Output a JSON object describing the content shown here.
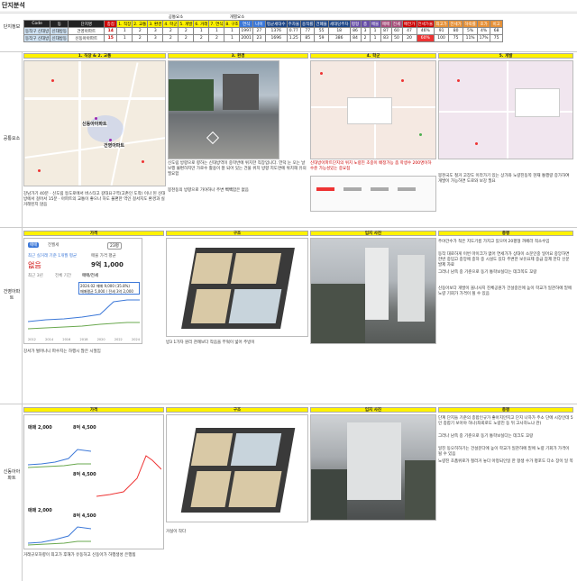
{
  "title": "단지분석",
  "summary": {
    "side_label": "단지정보",
    "group_common": "공통요소",
    "group_indiv": "개별요소",
    "headers": [
      "Code",
      "동",
      "단지명",
      "종점",
      "1. 직장",
      "2. 교통",
      "3. 환경",
      "4. 학군",
      "5. 개발",
      "6. 거래",
      "7. 연식",
      "8. 구조",
      "연식",
      "나이",
      "평균세대수",
      "주차율",
      "용적률",
      "건폐율",
      "세대당주차",
      "평형",
      "층",
      "매물",
      "매매",
      "전세",
      "매전가",
      "전세가율",
      "최고가",
      "전세가",
      "하락률",
      "호가",
      "비고"
    ],
    "rows": [
      [
        "동작구 신대방",
        "신대방동",
        "건영아파트",
        "14",
        "1",
        "2",
        "3",
        "2",
        "2",
        "1",
        "1",
        "1",
        "1997",
        "27",
        "1376",
        "0.77",
        "77",
        "55",
        "18",
        "86",
        "3",
        "1",
        "87",
        "60",
        "47",
        "46%",
        "91",
        "80",
        "5%",
        "4%",
        "68",
        "N"
      ],
      [
        "동작구 신대방",
        "신대방동",
        "신동아아파트",
        "15",
        "1",
        "2",
        "3",
        "2",
        "2",
        "2",
        "2",
        "1",
        "2001",
        "23",
        "1696",
        "1.25",
        "85",
        "59",
        "386",
        "84",
        "2",
        "1",
        "83",
        "50",
        "20",
        "60%",
        "100",
        "75",
        "11%",
        "17%",
        "75",
        "N"
      ]
    ]
  },
  "common": {
    "label": "공통요소",
    "tabs": [
      "1. 직장 & 2. 교통",
      "3. 환경",
      "4. 학군",
      "5. 개발"
    ],
    "map_labels": [
      "신동아아파트",
      "건영아파트"
    ],
    "notes": {
      "transport": "강남가기 40분 · 신도림 등도로에서 버스타고 갈대요구역(고촌인 도착) 이나 된 신대방에서 걸어서 15분 · 아파트의 교통이 좋으나 하도 불편한 역인 걸서지도 환경과 실거래된지 않음",
      "environment": "신도림 방향으로 향하는 신대방역이 중학반에 위치한 직장입니다. 언덕 눈 오는 날 보행 불편하지만 가로수 활용이 잘 되어 있는 건물 위치 방향 지도면에 위치해 유의 필요함",
      "environment2": "봉천동의 방향으로 가야하나 주변 빽빽함은 없음",
      "school": "신대방아파트단지의 위치 노량진 초중이 배정가능 좀 학생수 200명이하 수준 가능성있는 중요점",
      "develop": "봉천국도 철거 고장도 이라가기 있는 상가와 노량진동쪽 현재 통행량 증가하여 개발이 가능하면 도로와 보강 필요"
    }
  },
  "apt1": {
    "label": "건영아파트",
    "tabs": [
      "가격",
      "구조",
      "입지 사진",
      "총평"
    ],
    "price": {
      "btn_sale": "매매",
      "btn_jeonse": "전월세",
      "size": "23평",
      "caption": "최근 실거래 기준 1개월 평균",
      "avg_label": "없음",
      "ask_label": "매물 가격 평균",
      "ask_value": "9억 1,000",
      "tab_labels": [
        "최근 3년",
        "전체 기간",
        "매매/전세"
      ],
      "tooltip1": "2024.02  매매 9,000 (35.8%)",
      "tooltip2": "매매평균 5,000 / 전세 3억 2,000",
      "years": [
        "2012",
        "2014",
        "2016",
        "2018",
        "2020",
        "2022",
        "2024"
      ]
    },
    "structure_note": "방3 1가자 원리 관례보다 작음을 부엌이 넓어 주방이",
    "price_note": "강서가 벌어나니 파수지는 하행시 많은 시절임",
    "review": [
      "주야간수가 적은 지도기름 가지고 있으며 20평형 까페라 적소수임",
      "동작 대로하게 이번 마이크가 없어 연세가가 상대이 소문인중 일어요 중앙하면 한번 중입고 중앙에 중하 중 시설도 있다 주변한 보유요제 중급 잠제 한다 신문 발제 자료",
      "그러나 남쪽 중 기준으로 동기 통학보실다는 데크쪽도 꼬랑",
      "신동아보다 개발이 올나사지 진체공원가 건설중인에 높이 학교가 일관하에 밑에 노량 기회가 가격이 될 수 있음"
    ]
  },
  "apt2": {
    "label": "신동아아파트",
    "tabs": [
      "가격",
      "구조",
      "입지 사진",
      "총평"
    ],
    "price": {
      "size_a": "매매 2,000",
      "size_b": "8억 4,500",
      "size_c": "8억 4,500",
      "size_d": "매매 2,000",
      "size_e": "8억 4,500"
    },
    "structure_note": "거실이 작다",
    "price_note": "거래규모하향이 최고가 후해가 유동하고 신동아가 하행생성 은행됨",
    "review": [
      "단계 단지들 기준의 종합인규가 좋아지만지고 단지 나하가 주소 단에 시장인데 5인 종합기 보아야 하나(좌회로도 노량진 동 뒤 고사하느냐 관)",
      "그러나 남쪽 중 기준으로 동기 통학보실다는 데크도 꼬랑",
      "일진 동오히하기는 건설문다에 높이 학교가 일관하에 밑에 노량 기회가 가격이 될 수 있음",
      "노량진 초품위로가 철러거 놓다 아정되인일 한 항생 수가 평포도 다소 장이 일 쪽"
    ]
  }
}
